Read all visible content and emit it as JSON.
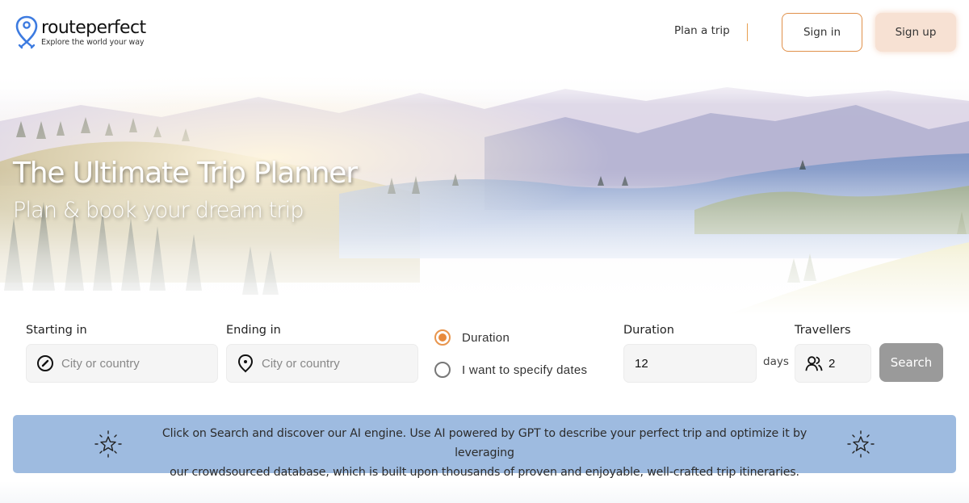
{
  "header": {
    "logo_name": "routeperfect",
    "logo_tagline": "Explore the world your way",
    "nav_plan_trip": "Plan a trip",
    "sign_in_label": "Sign in",
    "sign_up_label": "Sign up"
  },
  "hero": {
    "title": "The Ultimate Trip Planner",
    "subtitle": "Plan & book your dream trip"
  },
  "search": {
    "starting": {
      "label": "Starting in",
      "placeholder": "City or country",
      "value": "",
      "icon": "compass-icon"
    },
    "ending": {
      "label": "Ending in",
      "placeholder": "City or country",
      "value": "",
      "icon": "map-pin-icon"
    },
    "mode_options": [
      {
        "label": "Duration",
        "checked": true
      },
      {
        "label": "I want to specify dates",
        "checked": false
      }
    ],
    "duration": {
      "label": "Duration",
      "value": "12",
      "unit": "days"
    },
    "travellers": {
      "label": "Travellers",
      "value": "2",
      "icon": "users-icon"
    },
    "search_label": "Search"
  },
  "banner": {
    "icon": "sparkle-star-icon",
    "line1": "Click on Search and discover our AI engine. Use AI powered by GPT to describe your perfect trip and optimize it by leveraging",
    "line2": "our crowdsourced database, which is built upon thousands of proven and enjoyable, well-crafted trip itineraries."
  },
  "colors": {
    "accent": "#e88a3c",
    "sign_up_bg": "#f7e1d3",
    "banner_bg": "#9ebbe0",
    "search_button_bg": "#9a9a9a",
    "logo_blue": "#3d7be0"
  }
}
